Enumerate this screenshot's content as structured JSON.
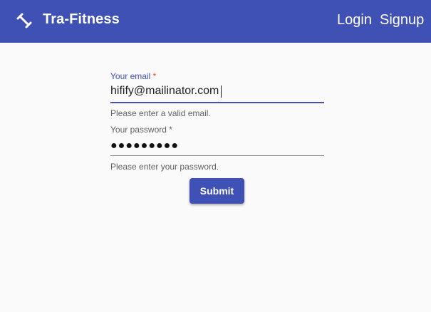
{
  "header": {
    "brand_icon": "fitness-dumbbell-icon",
    "title": "Tra-Fitness",
    "nav": {
      "login_label": "Login",
      "signup_label": "Signup"
    }
  },
  "form": {
    "email": {
      "label": "Your email",
      "required_mark": "*",
      "value": "hifify@mailinator.com",
      "hint": "Please enter a valid email."
    },
    "password": {
      "label": "Your password",
      "required_mark": "*",
      "masked_value": "●●●●●●●●●",
      "hint": "Please enter your password."
    },
    "submit_label": "Submit"
  },
  "colors": {
    "primary": "#3f51b5",
    "required": "#f44336",
    "background": "#fafafa"
  }
}
